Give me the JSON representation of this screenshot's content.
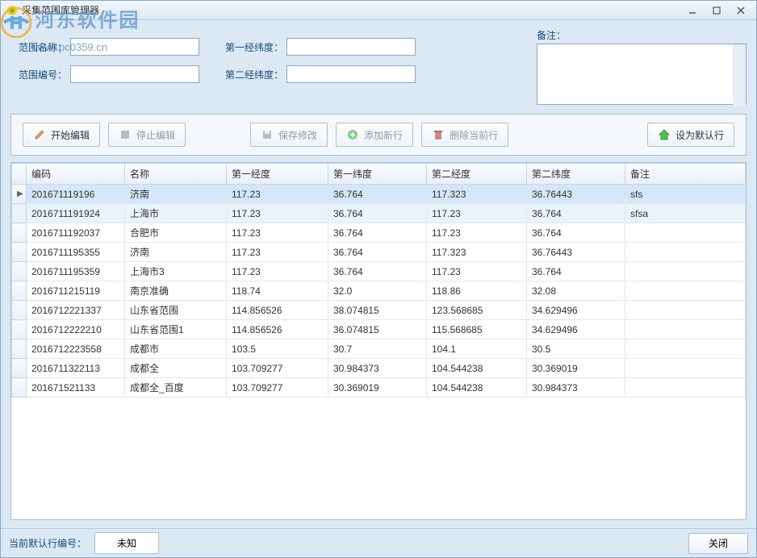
{
  "watermark": {
    "text": "河东软件园",
    "url": "www.pc0359.cn"
  },
  "window": {
    "title": "采集范围库管理器"
  },
  "form": {
    "name_label": "范围名称：",
    "code_label": "范围编号：",
    "coord1_label": "第一经纬度：",
    "coord2_label": "第二经纬度：",
    "remark_label": "备注：",
    "name_value": "",
    "code_value": "",
    "coord1_value": "",
    "coord2_value": "",
    "remark_value": ""
  },
  "toolbar": {
    "start_edit": "开始编辑",
    "stop_edit": "停止编辑",
    "save": "保存修改",
    "add_row": "添加新行",
    "delete_row": "删除当前行",
    "set_default": "设为默认行"
  },
  "table": {
    "headers": {
      "code": "编码",
      "name": "名称",
      "lon1": "第一经度",
      "lat1": "第一纬度",
      "lon2": "第二经度",
      "lat2": "第二纬度",
      "remark": "备注"
    },
    "rows": [
      {
        "code": "201671119196",
        "name": "济南",
        "lon1": "117.23",
        "lat1": "36.764",
        "lon2": "117.323",
        "lat2": "36.76443",
        "remark": "sfs"
      },
      {
        "code": "2016711191924",
        "name": "上海市",
        "lon1": "117.23",
        "lat1": "36.764",
        "lon2": "117.23",
        "lat2": "36.764",
        "remark": "sfsa"
      },
      {
        "code": "2016711192037",
        "name": "合肥市",
        "lon1": "117.23",
        "lat1": "36.764",
        "lon2": "117.23",
        "lat2": "36.764",
        "remark": ""
      },
      {
        "code": "2016711195355",
        "name": "济南",
        "lon1": "117.23",
        "lat1": "36.764",
        "lon2": "117.323",
        "lat2": "36.76443",
        "remark": ""
      },
      {
        "code": "2016711195359",
        "name": "上海市3",
        "lon1": "117.23",
        "lat1": "36.764",
        "lon2": "117.23",
        "lat2": "36.764",
        "remark": ""
      },
      {
        "code": "2016711215119",
        "name": "南京准确",
        "lon1": "118.74",
        "lat1": "32.0",
        "lon2": "118.86",
        "lat2": "32.08",
        "remark": ""
      },
      {
        "code": "2016712221337",
        "name": "山东省范围",
        "lon1": "114.856526",
        "lat1": "38.074815",
        "lon2": "123.568685",
        "lat2": "34.629496",
        "remark": ""
      },
      {
        "code": "2016712222210",
        "name": "山东省范围1",
        "lon1": "114.856526",
        "lat1": "36.074815",
        "lon2": "115.568685",
        "lat2": "34.629496",
        "remark": ""
      },
      {
        "code": "2016712223558",
        "name": "成都市",
        "lon1": "103.5",
        "lat1": "30.7",
        "lon2": "104.1",
        "lat2": "30.5",
        "remark": ""
      },
      {
        "code": "2016711322113",
        "name": "成都全",
        "lon1": "103.709277",
        "lat1": "30.984373",
        "lon2": "104.544238",
        "lat2": "30.369019",
        "remark": ""
      },
      {
        "code": "201671521133",
        "name": "成都全_百度",
        "lon1": "103.709277",
        "lat1": "30.369019",
        "lon2": "104.544238",
        "lat2": "30.984373",
        "remark": ""
      }
    ]
  },
  "footer": {
    "default_label": "当前默认行编号：",
    "default_value": "未知",
    "close": "关闭"
  }
}
